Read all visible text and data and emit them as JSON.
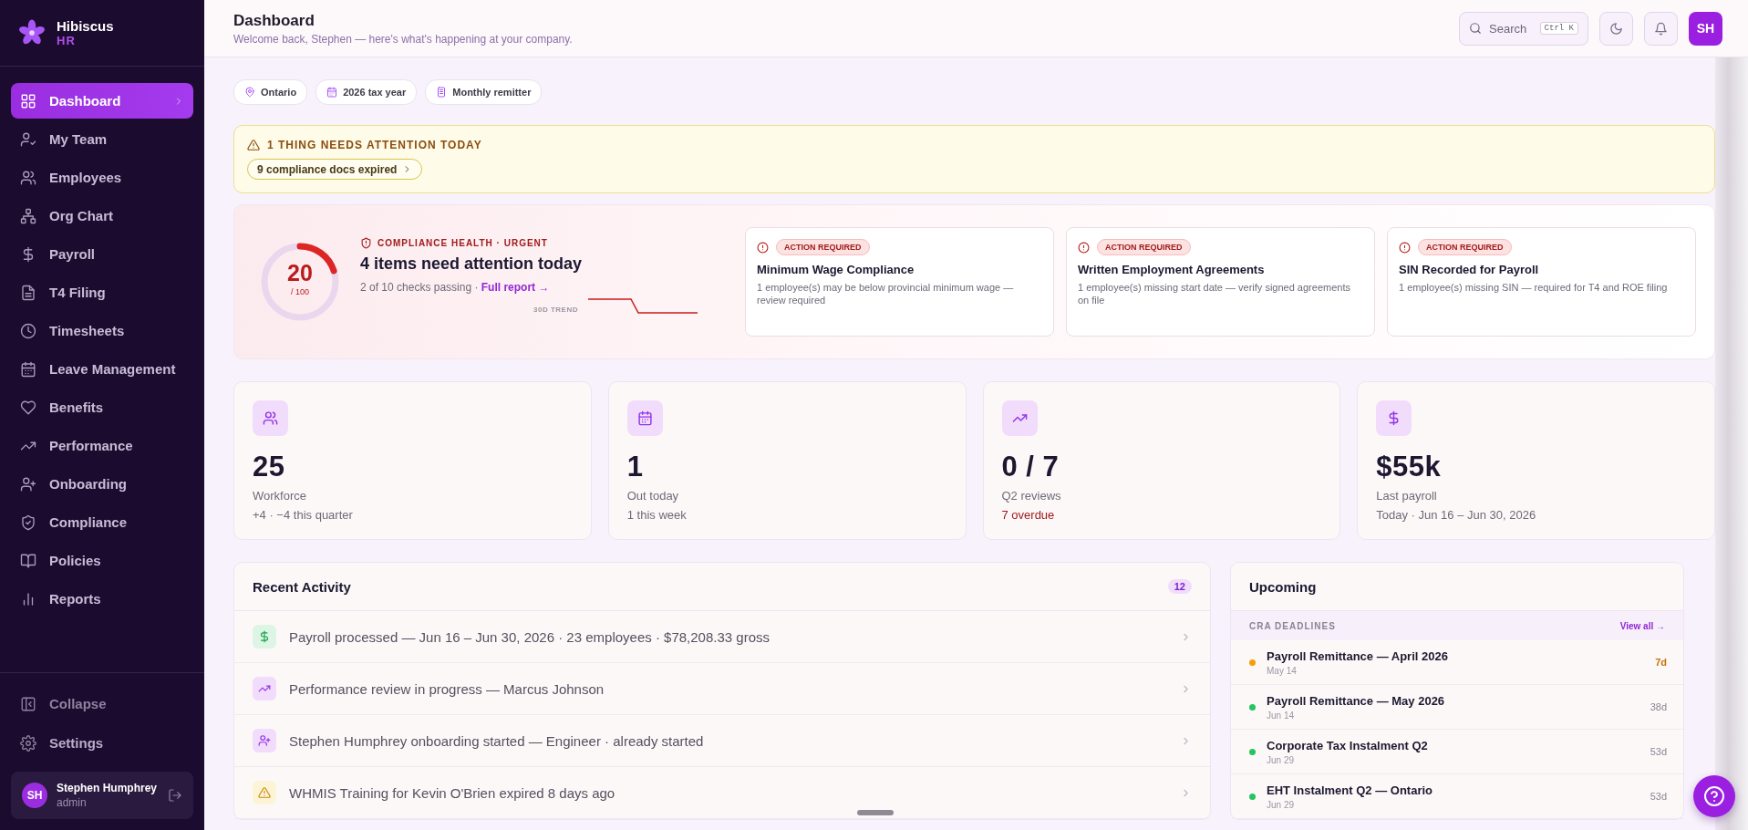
{
  "brand": {
    "name": "Hibiscus",
    "sub": "HR"
  },
  "sidebar": {
    "items": [
      {
        "label": "Dashboard",
        "selected": true
      },
      {
        "label": "My Team",
        "selected": false
      },
      {
        "label": "Employees",
        "selected": false
      },
      {
        "label": "Org Chart",
        "selected": false
      },
      {
        "label": "Payroll",
        "selected": false
      },
      {
        "label": "T4 Filing",
        "selected": false
      },
      {
        "label": "Timesheets",
        "selected": false
      },
      {
        "label": "Leave Management",
        "selected": false
      },
      {
        "label": "Benefits",
        "selected": false
      },
      {
        "label": "Performance",
        "selected": false
      },
      {
        "label": "Onboarding",
        "selected": false
      },
      {
        "label": "Compliance",
        "selected": false
      },
      {
        "label": "Policies",
        "selected": false
      },
      {
        "label": "Reports",
        "selected": false
      }
    ],
    "footer": [
      "Collapse",
      "Settings"
    ],
    "user": {
      "initials": "SH",
      "name": "Stephen Humphrey",
      "role": "admin"
    }
  },
  "header": {
    "title": "Dashboard",
    "subtitle": "Welcome back, Stephen — here's what's happening at your company.",
    "search": {
      "placeholder": "Search",
      "shortcut": "Ctrl K"
    },
    "avatar": "SH"
  },
  "chips": [
    "Ontario",
    "2026 tax year",
    "Monthly remitter"
  ],
  "alert": {
    "title": "1 THING NEEDS ATTENTION TODAY",
    "action": "9 compliance docs expired"
  },
  "compliance": {
    "score": "20",
    "max": "/ 100",
    "label": "COMPLIANCE HEALTH · URGENT",
    "headline": "4 items need attention today",
    "summary": "2 of 10 checks passing ·",
    "link": "Full report →",
    "trend_label": "30D TREND",
    "checks": [
      {
        "badge": "ACTION REQUIRED",
        "title": "Minimum Wage Compliance",
        "detail": "1 employee(s) may be below provincial minimum wage — review required"
      },
      {
        "badge": "ACTION REQUIRED",
        "title": "Written Employment Agreements",
        "detail": "1 employee(s) missing start date — verify signed agreements on file"
      },
      {
        "badge": "ACTION REQUIRED",
        "title": "SIN Recorded for Payroll",
        "detail": "1 employee(s) missing SIN — required for T4 and ROE filing"
      }
    ]
  },
  "stats": [
    {
      "value": "25",
      "label": "Workforce",
      "note": "+4 · −4 this quarter",
      "alert": false
    },
    {
      "value": "1",
      "label": "Out today",
      "note": "1 this week",
      "alert": false
    },
    {
      "value": "0 / 7",
      "label": "Q2 reviews",
      "note": "7 overdue",
      "alert": true
    },
    {
      "value": "$55k",
      "label": "Last payroll",
      "note": "Today · Jun 16 – Jun 30, 2026",
      "alert": false
    }
  ],
  "activity": {
    "title": "Recent Activity",
    "count": "12",
    "items": [
      {
        "kind": "payroll",
        "text": "Payroll processed — Jun 16 – Jun 30, 2026 · 23 employees · $78,208.33 gross"
      },
      {
        "kind": "review",
        "text": "Performance review in progress — Marcus Johnson"
      },
      {
        "kind": "onboarding",
        "text": "Stephen Humphrey onboarding started — Engineer · already started"
      },
      {
        "kind": "warning",
        "text": "WHMIS Training for Kevin O'Brien expired 8 days ago"
      }
    ]
  },
  "upcoming": {
    "title": "Upcoming",
    "section": "CRA DEADLINES",
    "link": "View all →",
    "items": [
      {
        "title": "Payroll Remittance — April 2026",
        "date": "May 14",
        "days": "7d",
        "color": "#f59e0b",
        "due_soon": true
      },
      {
        "title": "Payroll Remittance — May 2026",
        "date": "Jun 14",
        "days": "38d",
        "color": "#22c55e",
        "due_soon": false
      },
      {
        "title": "Corporate Tax Instalment Q2",
        "date": "Jun 29",
        "days": "53d",
        "color": "#22c55e",
        "due_soon": false
      },
      {
        "title": "EHT Instalment Q2 — Ontario",
        "date": "Jun 29",
        "days": "53d",
        "color": "#22c55e",
        "due_soon": false
      }
    ]
  }
}
